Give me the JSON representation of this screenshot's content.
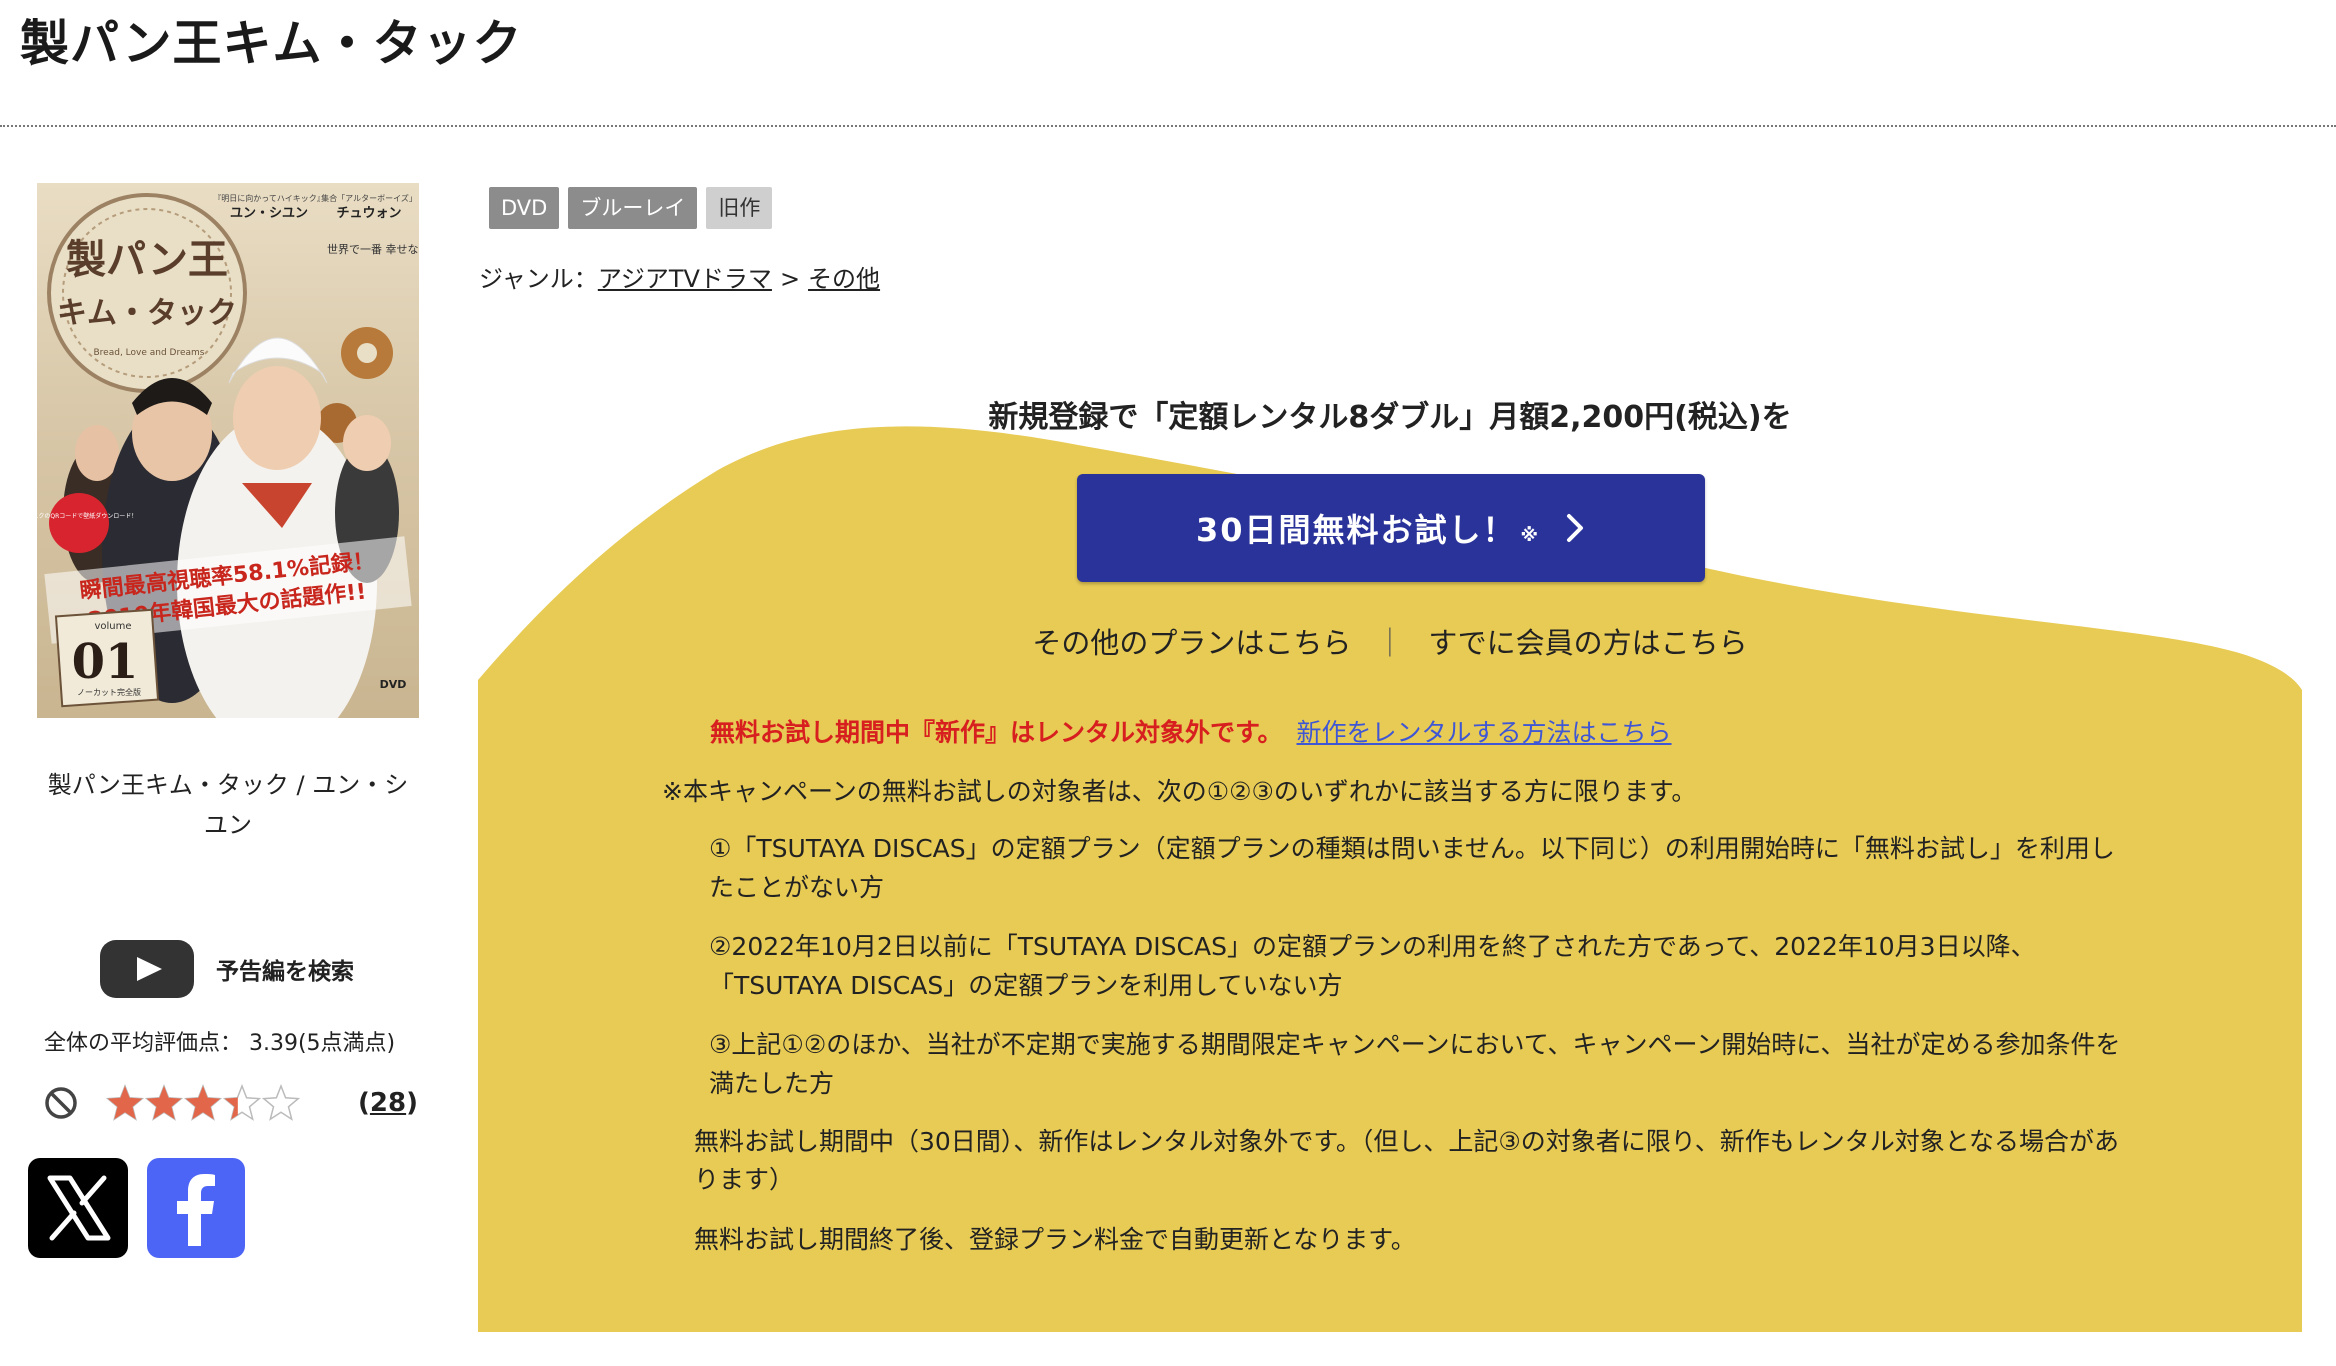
{
  "page": {
    "title": "製パン王キム・タック"
  },
  "sidebar": {
    "cover_caption": "製パン王キム・タック / ユン・シユン",
    "trailer_label": "予告編を検索",
    "rating_label": "全体の平均評価点： 3.39(5点満点)",
    "rating_value": 3.39,
    "rating_max": 5,
    "rating_count_open": "(",
    "rating_count": "28",
    "rating_count_close": ")",
    "star_color": "#e2674a",
    "share": {
      "x_icon": "x-logo-icon",
      "facebook_icon": "facebook-logo-icon",
      "facebook_color": "#4d65f6"
    }
  },
  "cover_art": {
    "top_line_1": "『明日に向かってハイキック』",
    "top_name_1": "ユン・シユン",
    "top_line_2": "集合「アルターボーイズ」",
    "top_name_2": "チュウォン",
    "logo_line_1": "製パン王",
    "logo_line_2": "キム・タック",
    "logo_sub": "Bread, Love and Dreams",
    "tagline": "世界で一番 幸せなパン、できました。",
    "bubble": "ディスクのQRコードで壁紙ダウンロード！",
    "banner_1": "瞬間最高視聴率58.1%記録！",
    "banner_2": "2010年韓国最大の話題作!!",
    "volume_label": "volume",
    "volume": "01",
    "volume_sub": "ノーカット完全版",
    "dvd_mark": "DVD"
  },
  "detail": {
    "tags": [
      "DVD",
      "ブルーレイ",
      "旧作"
    ],
    "genre_label": "ジャンル：",
    "genre_links": [
      "アジアTVドラマ",
      "その他"
    ],
    "genre_separator": ">"
  },
  "campaign": {
    "background_color": "#e8cb55",
    "button_color": "#2a3399",
    "heading": "新規登録で「定額レンタル8ダブル」月額2,200円(税込)を",
    "button_label": "30日間無料お試し！",
    "button_mark": "※",
    "other_plans_link": "その他のプランはこちら",
    "link_separator": "｜",
    "members_link": "すでに会員の方はこちら",
    "notice_red": "無料お試し期間中『新作』はレンタル対象外です。",
    "notice_link": "新作をレンタルする方法はこちら",
    "terms_intro": "※本キャンペーンの無料お試しの対象者は、次の①②③のいずれかに該当する方に限ります。",
    "conditions": [
      "①「TSUTAYA DISCAS」の定額プラン（定額プランの種類は問いません。以下同じ）の利用開始時に「無料お試し」を利用したことがない方",
      "②2022年10月2日以前に「TSUTAYA DISCAS」の定額プランの利用を終了された方であって、2022年10月3日以降、「TSUTAYA DISCAS」の定額プランを利用していない方",
      "③上記①②のほか、当社が不定期で実施する期間限定キャンペーンにおいて、キャンペーン開始時に、当社が定める参加条件を満たした方"
    ],
    "notes": [
      "無料お試し期間中（30日間）、新作はレンタル対象外です。（但し、上記③の対象者に限り、新作もレンタル対象となる場合があります）",
      "無料お試し期間終了後、登録プラン料金で自動更新となります。"
    ]
  }
}
